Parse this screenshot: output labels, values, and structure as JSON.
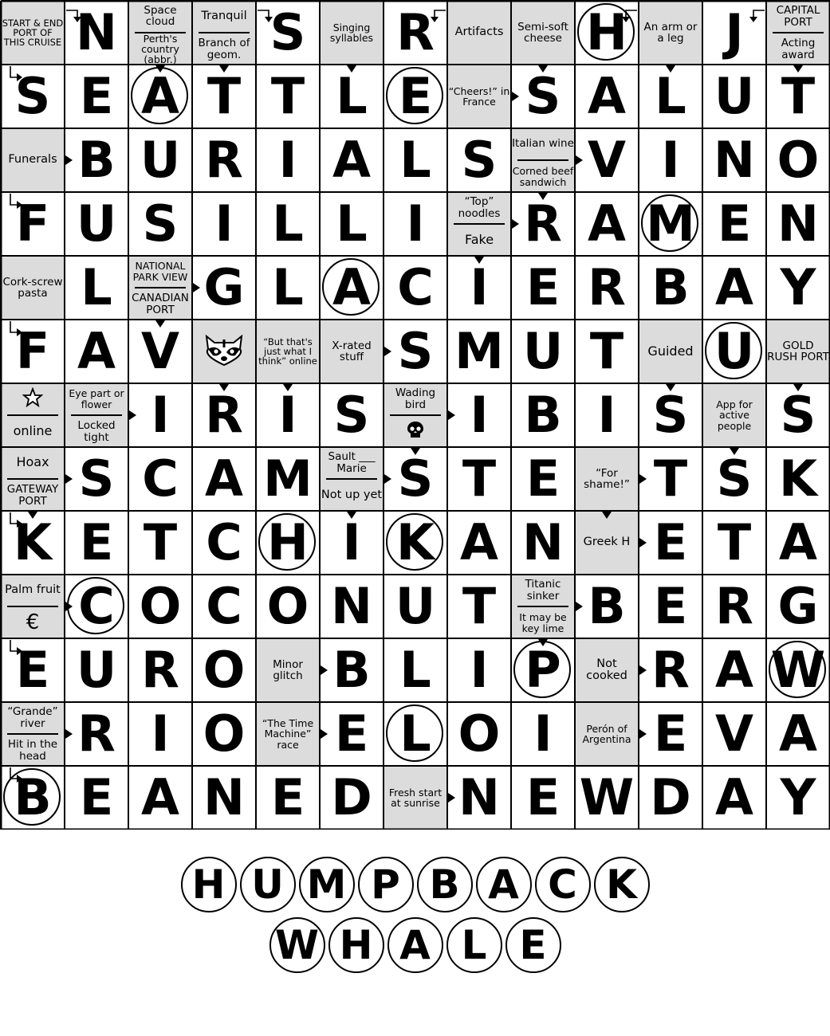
{
  "puzzle": {
    "rows": 13,
    "cols": 13,
    "grid": [
      [
        {
          "clue": [
            "START & END PORT OF THIS CRUISE"
          ]
        },
        "N",
        {
          "clue": [
            "Space cloud",
            "Perth's country (abbr.)"
          ]
        },
        {
          "clue": [
            "Tranquil",
            "Branch of geom."
          ]
        },
        "S",
        {
          "clue": [
            "Singing syllables"
          ]
        },
        "R",
        {
          "clue": [
            "Artifacts"
          ]
        },
        {
          "clue": [
            "Semi-soft cheese"
          ]
        },
        "H",
        {
          "clue": [
            "An arm or a leg"
          ]
        },
        "J",
        {
          "clue": [
            "CAPITAL PORT",
            "Acting award"
          ]
        }
      ],
      [
        "S",
        "E",
        "A",
        "T",
        "T",
        "L",
        "E",
        {
          "clue": [
            "“Cheers!” in France"
          ]
        },
        "S",
        "A",
        "L",
        "U",
        "T"
      ],
      [
        {
          "clue": [
            "Funerals"
          ]
        },
        "B",
        "U",
        "R",
        "I",
        "A",
        "L",
        "S",
        {
          "clue": [
            "Italian wine",
            "Corned beef sandwich"
          ]
        },
        "V",
        "I",
        "N",
        "O"
      ],
      [
        "F",
        "U",
        "S",
        "I",
        "L",
        "L",
        "I",
        {
          "clue": [
            "“Top” noodles",
            "Fake"
          ]
        },
        "R",
        "A",
        "M",
        "E",
        "N"
      ],
      [
        {
          "clue": [
            "Cork-screw pasta"
          ]
        },
        "L",
        {
          "clue": [
            "NATIONAL PARK VIEW",
            "CANADIAN PORT"
          ]
        },
        "G",
        "L",
        "A",
        "C",
        "I",
        "E",
        "R",
        "B",
        "A",
        "Y"
      ],
      [
        "F",
        "A",
        "V",
        {
          "clue": [
            "raccoon-icon"
          ],
          "icon": true
        },
        {
          "clue": [
            "“But that's just what I think” online"
          ]
        },
        {
          "clue": [
            "X-rated stuff"
          ]
        },
        "S",
        "M",
        "U",
        "T",
        {
          "clue": [
            "Guided"
          ]
        },
        "U",
        {
          "clue": [
            "GOLD RUSH PORT"
          ]
        }
      ],
      [
        {
          "clue": [
            "star-icon",
            "online"
          ],
          "iconTop": true
        },
        {
          "clue": [
            "Eye part or flower",
            "Locked tight"
          ]
        },
        "I",
        "R",
        "I",
        "S",
        {
          "clue": [
            "Wading bird",
            "skull-icon"
          ],
          "iconBottom": true
        },
        "I",
        "B",
        "I",
        "S",
        {
          "clue": [
            "App for active people"
          ]
        },
        "S"
      ],
      [
        {
          "clue": [
            "Hoax",
            "GATEWAY PORT"
          ]
        },
        "S",
        "C",
        "A",
        "M",
        {
          "clue": [
            "Sault ___ Marie",
            "Not up yet"
          ]
        },
        "S",
        "T",
        "E",
        {
          "clue": [
            "“For shame!”"
          ]
        },
        "T",
        "S",
        "K"
      ],
      [
        "K",
        "E",
        "T",
        "C",
        "H",
        "I",
        "K",
        "A",
        "N",
        {
          "clue": [
            "Greek H"
          ]
        },
        "E",
        "T",
        "A"
      ],
      [
        {
          "clue": [
            "Palm fruit",
            "€"
          ]
        },
        "C",
        "O",
        "C",
        "O",
        "N",
        "U",
        "T",
        {
          "clue": [
            "Titanic sinker",
            "It may be key lime"
          ]
        },
        "B",
        "E",
        "R",
        "G"
      ],
      [
        "E",
        "U",
        "R",
        "O",
        {
          "clue": [
            "Minor glitch"
          ]
        },
        "B",
        "L",
        "I",
        "P",
        {
          "clue": [
            "Not cooked"
          ]
        },
        "R",
        "A",
        "W"
      ],
      [
        {
          "clue": [
            "“Grande” river",
            "Hit in the head"
          ]
        },
        "R",
        "I",
        "O",
        {
          "clue": [
            "“The Time Machine” race"
          ]
        },
        "E",
        "L",
        "O",
        "I",
        {
          "clue": [
            "Perón of Argentina"
          ]
        },
        "E",
        "V",
        "A"
      ],
      [
        "B",
        "E",
        "A",
        "N",
        "E",
        "D",
        {
          "clue": [
            "Fresh start at sunrise"
          ]
        },
        "N",
        "E",
        "W",
        "D",
        "A",
        "Y"
      ]
    ],
    "circled_cells": [
      "0-9",
      "1-2",
      "1-6",
      "3-10",
      "4-5",
      "5-11",
      "8-4",
      "8-6",
      "9-1",
      "10-8",
      "10-12",
      "11-6",
      "12-0"
    ],
    "answer": {
      "line1": [
        "H",
        "U",
        "M",
        "P",
        "B",
        "A",
        "C",
        "K"
      ],
      "line2": [
        "W",
        "H",
        "A",
        "L",
        "E"
      ]
    }
  },
  "colors": {
    "clue_bg": "#dcdcdc",
    "line": "#000000",
    "background": "#ffffff"
  }
}
